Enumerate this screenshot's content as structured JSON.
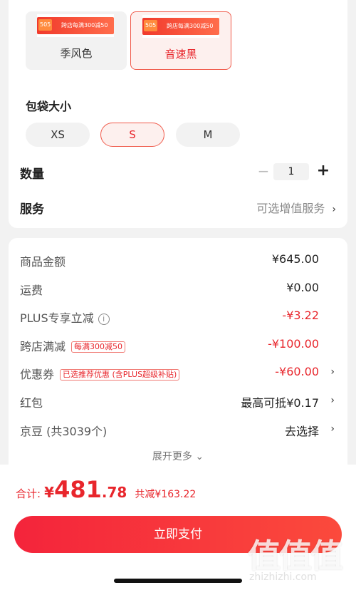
{
  "colors": {
    "accent": "#e8262c",
    "selected_bg": "#fdf0ee",
    "pay_button": "#f4243b"
  },
  "color_options": [
    {
      "label": "季风色",
      "banner_chip": "505",
      "banner_text": "跨店每满300减50",
      "selected": false
    },
    {
      "label": "音速黑",
      "banner_chip": "505",
      "banner_text": "跨店每满300减50",
      "selected": true
    }
  ],
  "bag_size": {
    "title": "包袋大小",
    "options": [
      {
        "label": "XS",
        "selected": false
      },
      {
        "label": "S",
        "selected": true
      },
      {
        "label": "M",
        "selected": false
      }
    ]
  },
  "quantity": {
    "title": "数量",
    "minus": "−",
    "value": "1",
    "plus": "+"
  },
  "service": {
    "title": "服务",
    "hint": "可选增值服务",
    "chevron": "›"
  },
  "price_rows": [
    {
      "label": "商品金额",
      "value": "¥645.00"
    },
    {
      "label": "运费",
      "value": "¥0.00"
    },
    {
      "label": "PLUS专享立减",
      "value": "-¥3.22",
      "info_icon": "i"
    },
    {
      "label": "跨店满减",
      "tag": "每满300减50",
      "value": "-¥100.00"
    },
    {
      "label": "优惠券",
      "tag": "已选推荐优惠 (含PLUS超级补贴)",
      "value": "-¥60.00",
      "chevron": "›"
    },
    {
      "label": "红包",
      "value": "最高可抵¥0.17",
      "chevron": "›"
    },
    {
      "label": "京豆 (共3039个)",
      "value": "去选择",
      "chevron": "›"
    }
  ],
  "expand_more": "展开更多 ⌄",
  "total": {
    "label": "合计:",
    "currency": "¥",
    "integer": "481",
    "decimal": ".78",
    "savings": "共减¥163.22"
  },
  "pay_button": "立即支付",
  "watermark": {
    "main": "值值值",
    "sub": "zhizhizhi.com"
  }
}
